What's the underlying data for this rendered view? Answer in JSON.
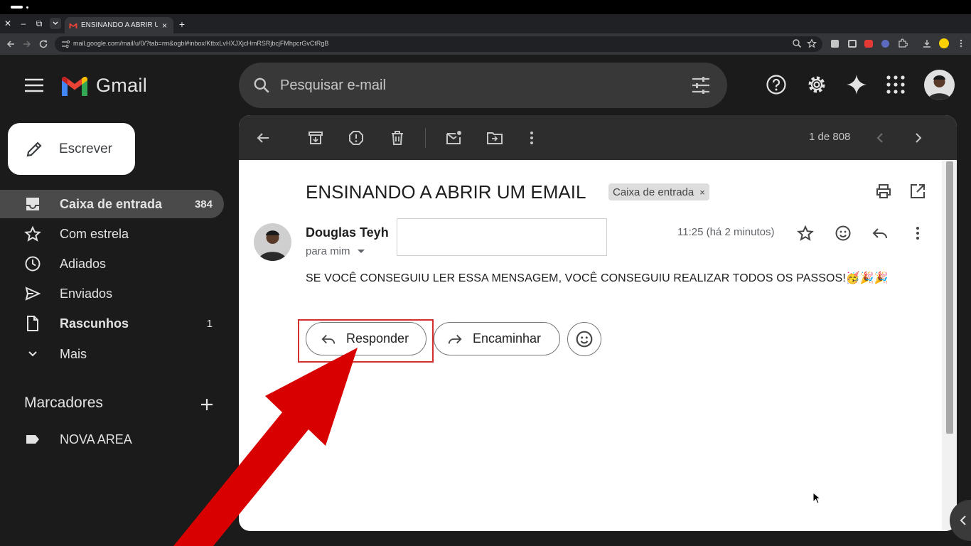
{
  "browser": {
    "tab_title": "ENSINANDO A ABRIR UM EMAIL",
    "url": "mail.google.com/mail/u/0/?tab=rm&ogbl#inbox/KtbxLvHXJXjcHmRSRjbcjFMhpcrGvCtRgB",
    "tab_close": "×",
    "new_tab": "+"
  },
  "gmail": {
    "app_name": "Gmail",
    "search_placeholder": "Pesquisar e-mail",
    "compose_label": "Escrever",
    "nav": [
      {
        "label": "Caixa de entrada",
        "count": "384",
        "icon": "inbox-icon"
      },
      {
        "label": "Com estrela",
        "count": "",
        "icon": "star-icon"
      },
      {
        "label": "Adiados",
        "count": "",
        "icon": "clock-icon"
      },
      {
        "label": "Enviados",
        "count": "",
        "icon": "send-icon"
      },
      {
        "label": "Rascunhos",
        "count": "1",
        "icon": "draft-icon"
      },
      {
        "label": "Mais",
        "count": "",
        "icon": "chevron-down-icon"
      }
    ],
    "labels_heading": "Marcadores",
    "labels": [
      {
        "label": "NOVA AREA",
        "icon": "label-icon"
      }
    ],
    "pager": "1 de 808"
  },
  "email": {
    "subject": "ENSINANDO A ABRIR UM EMAIL",
    "label_chip": "Caixa de entrada",
    "chip_remove": "×",
    "sender": "Douglas Teyh",
    "recipient": "para mim",
    "time": "11:25 (há 2 minutos)",
    "body": "SE VOCÊ CONSEGUIU LER ESSA MENSAGEM, VOCÊ CONSEGUIU REALIZAR TODOS OS PASSOS!🥳🎉🎉",
    "reply_label": "Responder",
    "forward_label": "Encaminhar"
  },
  "colors": {
    "annotation_red": "#d80000",
    "gmail_red": "#ea4335",
    "gmail_blue": "#4285f4",
    "gmail_green": "#34a853",
    "gmail_yellow": "#fbbc04"
  }
}
